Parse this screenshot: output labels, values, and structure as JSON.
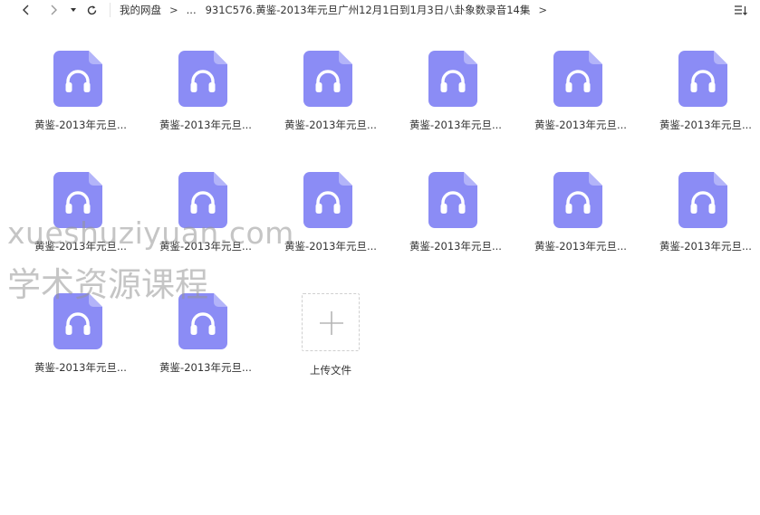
{
  "toolbar": {
    "breadcrumb_root": "我的网盘",
    "breadcrumb_separator": ">",
    "breadcrumb_ellipsis": "...",
    "breadcrumb_current": "931C576.黄鉴-2013年元旦广州12月1日到1月3日八卦象数录音14集",
    "breadcrumb_trailing": ">"
  },
  "icons": {
    "back": "chevron-left-icon",
    "forward": "chevron-right-icon",
    "history": "caret-down-icon",
    "refresh": "refresh-icon",
    "sort": "sort-icon",
    "audio_file": "audio-file-icon",
    "upload": "plus-icon"
  },
  "colors": {
    "audio_icon": "#8b8cf5",
    "audio_icon_fold": "#b3b4f9"
  },
  "files": [
    {
      "name": "黄鉴-2013年元旦..."
    },
    {
      "name": "黄鉴-2013年元旦..."
    },
    {
      "name": "黄鉴-2013年元旦..."
    },
    {
      "name": "黄鉴-2013年元旦..."
    },
    {
      "name": "黄鉴-2013年元旦..."
    },
    {
      "name": "黄鉴-2013年元旦..."
    },
    {
      "name": "黄鉴-2013年元旦..."
    },
    {
      "name": "黄鉴-2013年元旦..."
    },
    {
      "name": "黄鉴-2013年元旦..."
    },
    {
      "name": "黄鉴-2013年元旦..."
    },
    {
      "name": "黄鉴-2013年元旦..."
    },
    {
      "name": "黄鉴-2013年元旦..."
    },
    {
      "name": "黄鉴-2013年元旦..."
    },
    {
      "name": "黄鉴-2013年元旦..."
    }
  ],
  "upload": {
    "label": "上传文件"
  },
  "watermark": {
    "line1": "xueshuziyuan.com",
    "line2": "学术资源课程"
  }
}
